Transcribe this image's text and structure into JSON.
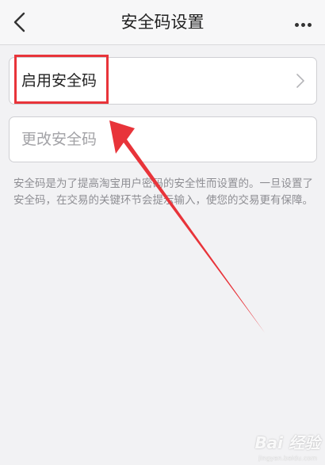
{
  "nav": {
    "title": "安全码设置",
    "back_icon": "chevron-left-icon",
    "more_icon": "more-icon"
  },
  "rows": [
    {
      "label": "启用安全码",
      "icon": "chevron-right-icon"
    },
    {
      "label": "更改安全码"
    }
  ],
  "description": "安全码是为了提高淘宝用户密码的安全性而设置的。一旦设置了安全码，在交易的关键环节会提示输入，使您的交易更有保障。",
  "annotation": {
    "highlight_color": "#e8343a",
    "arrow_color": "#e8343a"
  },
  "watermark": {
    "logo": "Bai 经验",
    "url": "jingyan.baidu.com"
  }
}
